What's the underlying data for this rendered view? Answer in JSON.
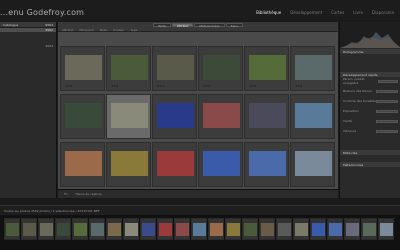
{
  "brand": "...enu Godefroy.com",
  "modules": [
    {
      "label": "Bibliothèque",
      "active": true
    },
    {
      "label": "Développement",
      "active": false
    },
    {
      "label": "Cartes",
      "active": false
    },
    {
      "label": "Livre",
      "active": false
    },
    {
      "label": "Diaporama",
      "active": false
    }
  ],
  "left_panel": {
    "header": "Catalogue",
    "header_count": "9563",
    "rows": [
      {
        "label": "",
        "count": "4562",
        "selected": true
      },
      {
        "label": "",
        "count": "",
        "selected": false
      },
      {
        "label": "",
        "count": "",
        "selected": false
      },
      {
        "label": "",
        "count": "",
        "selected": false
      },
      {
        "label": "",
        "count": "4564",
        "selected": false
      },
      {
        "label": "",
        "count": "",
        "selected": false
      },
      {
        "label": "",
        "count": "",
        "selected": false
      },
      {
        "label": "",
        "count": "",
        "selected": false
      },
      {
        "label": "",
        "count": "",
        "selected": false
      },
      {
        "label": "",
        "count": "",
        "selected": false
      },
      {
        "label": "",
        "count": "",
        "selected": false
      },
      {
        "label": "",
        "count": "",
        "selected": false
      },
      {
        "label": "",
        "count": "",
        "selected": false
      },
      {
        "label": "",
        "count": "",
        "selected": false
      },
      {
        "label": "",
        "count": "",
        "selected": false
      },
      {
        "label": "",
        "count": "",
        "selected": false
      },
      {
        "label": "",
        "count": "",
        "selected": false
      },
      {
        "label": "",
        "count": "",
        "selected": false
      },
      {
        "label": "",
        "count": "",
        "selected": false
      },
      {
        "label": "",
        "count": "",
        "selected": false
      },
      {
        "label": "",
        "count": "",
        "selected": false
      },
      {
        "label": "",
        "count": "",
        "selected": false
      },
      {
        "label": "",
        "count": "",
        "selected": false
      },
      {
        "label": "",
        "count": "",
        "selected": false
      },
      {
        "label": "",
        "count": "",
        "selected": false
      },
      {
        "label": "",
        "count": "",
        "selected": false
      },
      {
        "label": "",
        "count": "",
        "selected": false
      },
      {
        "label": "",
        "count": "",
        "selected": false
      },
      {
        "label": "",
        "count": "",
        "selected": false
      },
      {
        "label": "",
        "count": "",
        "selected": false
      },
      {
        "label": "",
        "count": "",
        "selected": false
      },
      {
        "label": "",
        "count": "",
        "selected": false
      }
    ]
  },
  "filter": {
    "tabs": [
      {
        "label": "Texte",
        "on": false
      },
      {
        "label": "Attribut",
        "on": true
      },
      {
        "label": "Métadonnées",
        "on": false
      },
      {
        "label": "Sans",
        "on": false
      }
    ],
    "row_text": [
      "Attribut",
      "Marqueur",
      "Note",
      "Couleur",
      "Type"
    ]
  },
  "grid": {
    "cells": [
      {
        "num": "",
        "thumb": "#6b6a5a",
        "stars": "★★★",
        "selected": false
      },
      {
        "num": "",
        "thumb": "#4a5a3a",
        "stars": "★★★",
        "selected": false
      },
      {
        "num": "",
        "thumb": "#5a5a4a",
        "stars": "★★★",
        "selected": false
      },
      {
        "num": "",
        "thumb": "#3d4a3a",
        "stars": "★★★",
        "selected": false
      },
      {
        "num": "",
        "thumb": "#556b3a",
        "stars": "★★★",
        "selected": false
      },
      {
        "num": "",
        "thumb": "#5a6a6a",
        "stars": "★★★",
        "selected": false
      },
      {
        "num": "",
        "thumb": "#3a4a3a",
        "stars": "",
        "selected": false
      },
      {
        "num": "",
        "thumb": "#8a8a7a",
        "stars": "",
        "selected": true
      },
      {
        "num": "",
        "thumb": "#2a3a8a",
        "stars": "",
        "selected": false
      },
      {
        "num": "",
        "thumb": "#8a4a4a",
        "stars": "",
        "selected": false
      },
      {
        "num": "",
        "thumb": "#4a4a5a",
        "stars": "",
        "selected": false
      },
      {
        "num": "",
        "thumb": "#5a7a9a",
        "stars": "",
        "selected": false
      },
      {
        "num": "",
        "thumb": "#9a6a4a",
        "stars": "",
        "selected": false
      },
      {
        "num": "",
        "thumb": "#8a7a3a",
        "stars": "",
        "selected": false
      },
      {
        "num": "",
        "thumb": "#9a3a3a",
        "stars": "",
        "selected": false
      },
      {
        "num": "",
        "thumb": "#3a5aaa",
        "stars": "",
        "selected": false
      },
      {
        "num": "",
        "thumb": "#4a6aaa",
        "stars": "",
        "selected": false
      },
      {
        "num": "",
        "thumb": "#7a8a9a",
        "stars": "",
        "selected": false
      }
    ]
  },
  "toolbar": {
    "items": [
      "Tri :",
      "Heure de capture"
    ]
  },
  "right_panel": {
    "sections": [
      {
        "label": "Histogramme"
      },
      {
        "label": "Développement rapide"
      },
      {
        "label": "Mots-clés"
      },
      {
        "label": "Métadonnées"
      }
    ],
    "rows": [
      {
        "label": "Param. prédéf. enregistré",
        "value": ""
      },
      {
        "label": "Balance des blancs",
        "value": ""
      },
      {
        "label": "Contrôle des tonalités",
        "value": ""
      },
      {
        "label": "Exposition",
        "value": ""
      },
      {
        "label": "Clarté",
        "value": ""
      },
      {
        "label": "Vibrance",
        "value": ""
      }
    ]
  },
  "pathbar": {
    "text": "Toutes les photos  4562 photos / 1 sélectionnée / 20110101.NEF"
  },
  "filmstrip": {
    "thumbs": [
      "#4a5a3a",
      "#5a5a4a",
      "#6a6a5a",
      "#3a4a3a",
      "#556b3a",
      "#5a6a6a",
      "#7a6a4a",
      "#8a8a7a",
      "#3a4a8a",
      "#9a3a3a",
      "#8a4a4a",
      "#5a7a9a",
      "#9a6a4a",
      "#8a7a3a",
      "#4a5a3a",
      "#6a5a4a",
      "#5a5a5a",
      "#7a7a6a",
      "#3a5aaa",
      "#4a6aaa",
      "#6a6a7a",
      "#5a6a5a",
      "#7a8a9a"
    ]
  }
}
